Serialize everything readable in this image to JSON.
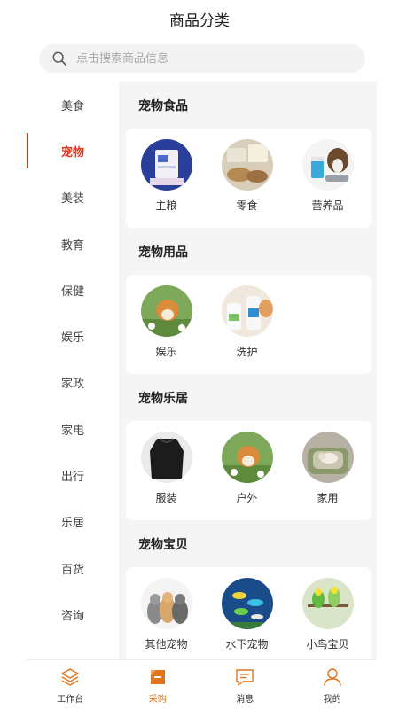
{
  "header": {
    "title": "商品分类"
  },
  "search": {
    "placeholder": "点击搜索商品信息"
  },
  "sidebar": {
    "items": [
      {
        "label": "美食"
      },
      {
        "label": "宠物",
        "active": true
      },
      {
        "label": "美装"
      },
      {
        "label": "教育"
      },
      {
        "label": "保健"
      },
      {
        "label": "娱乐"
      },
      {
        "label": "家政"
      },
      {
        "label": "家电"
      },
      {
        "label": "出行"
      },
      {
        "label": "乐居"
      },
      {
        "label": "百货"
      },
      {
        "label": "咨询"
      }
    ]
  },
  "sections": [
    {
      "title": "宠物食品",
      "items": [
        {
          "label": "主粮"
        },
        {
          "label": "零食"
        },
        {
          "label": "营养品"
        }
      ]
    },
    {
      "title": "宠物用品",
      "items": [
        {
          "label": "娱乐"
        },
        {
          "label": "洗护"
        }
      ]
    },
    {
      "title": "宠物乐居",
      "items": [
        {
          "label": "服装"
        },
        {
          "label": "户外"
        },
        {
          "label": "家用"
        }
      ]
    },
    {
      "title": "宠物宝贝",
      "items": [
        {
          "label": "其他宠物"
        },
        {
          "label": "水下宠物"
        },
        {
          "label": "小鸟宝贝"
        }
      ]
    }
  ],
  "tabbar": {
    "items": [
      {
        "label": "工作台"
      },
      {
        "label": "采购",
        "active": true
      },
      {
        "label": "消息"
      },
      {
        "label": "我的"
      }
    ]
  },
  "colors": {
    "accent": "#e0341c",
    "tab_accent": "#e0741c",
    "content_bg": "#f5f5f5"
  }
}
